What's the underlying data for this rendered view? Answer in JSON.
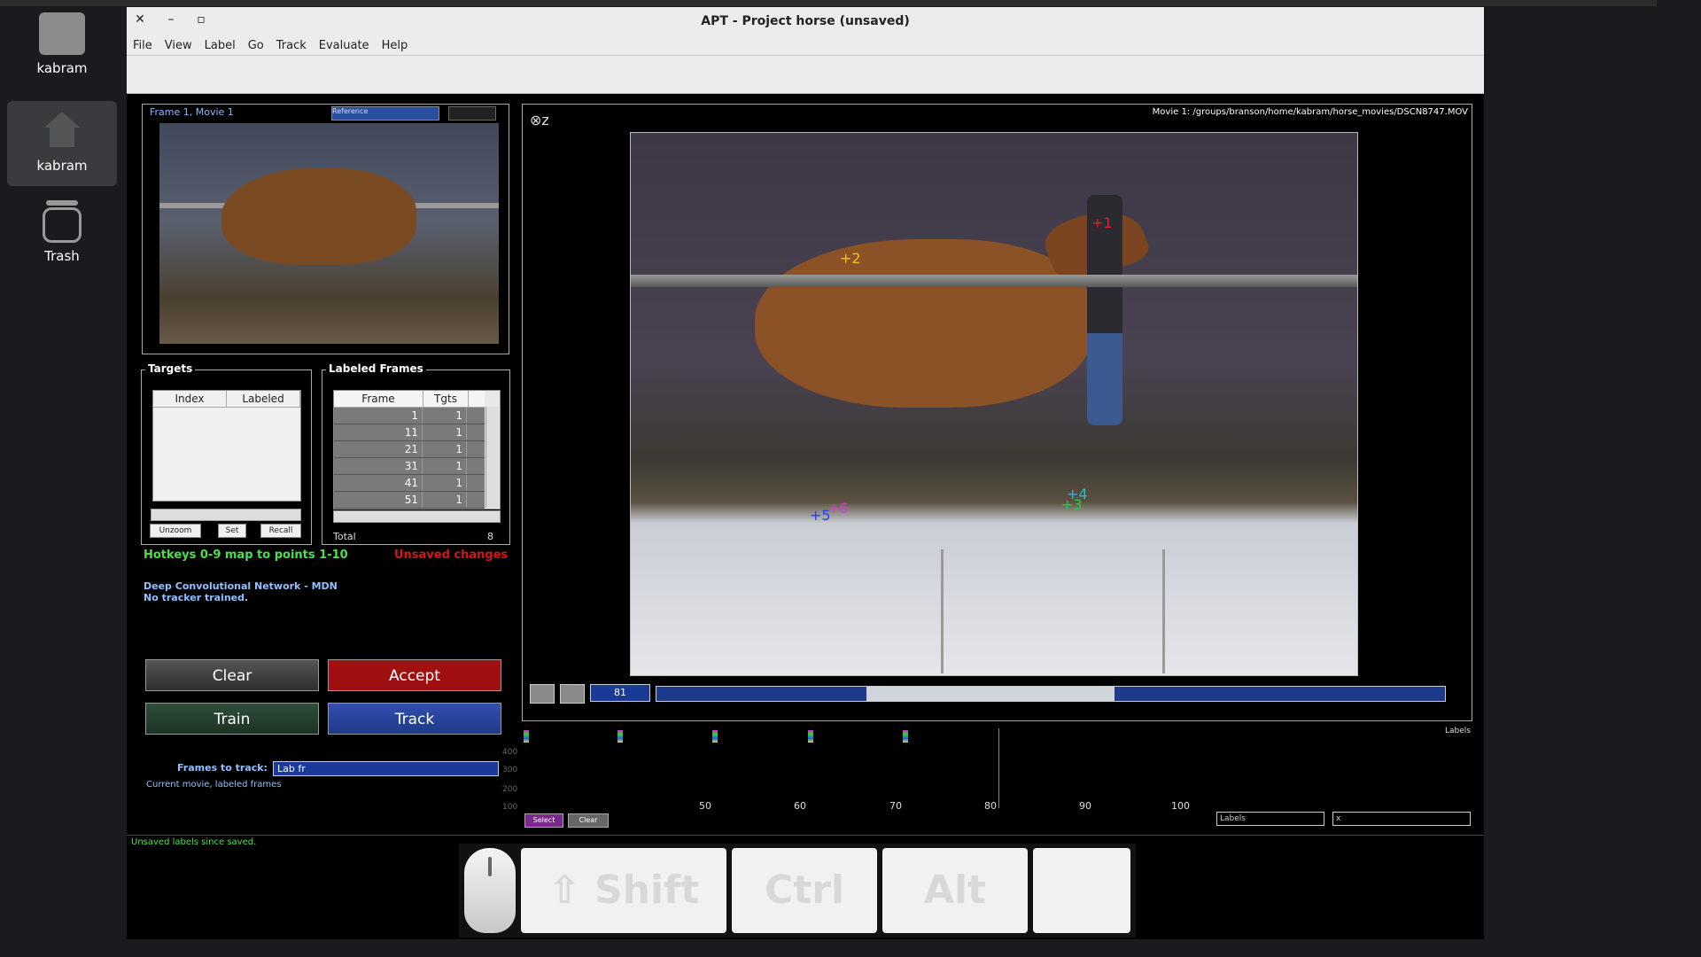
{
  "desktop": {
    "icons": [
      {
        "label": "kabram",
        "icon": "folder-icon"
      },
      {
        "label": "kabram",
        "icon": "home-icon"
      },
      {
        "label": "Trash",
        "icon": "trash-icon"
      }
    ]
  },
  "window": {
    "title": "APT - Project horse (unsaved)",
    "controls": {
      "close": "✕",
      "minimize": "–",
      "maximize": "▫"
    },
    "menu": [
      "File",
      "View",
      "Label",
      "Go",
      "Track",
      "Evaluate",
      "Help"
    ]
  },
  "reference_pane": {
    "label": "Frame 1, Movie 1",
    "select_value": "Reference"
  },
  "targets": {
    "title": "Targets",
    "columns": [
      "Index",
      "Labeled"
    ],
    "buttons": {
      "unzoom": "Unzoom",
      "set": "Set",
      "recall": "Recall"
    }
  },
  "labeled_frames": {
    "title": "Labeled Frames",
    "columns": [
      "Frame",
      "Tgts"
    ],
    "rows": [
      {
        "frame": "1",
        "tgts": "1"
      },
      {
        "frame": "11",
        "tgts": "1"
      },
      {
        "frame": "21",
        "tgts": "1"
      },
      {
        "frame": "31",
        "tgts": "1"
      },
      {
        "frame": "41",
        "tgts": "1"
      },
      {
        "frame": "51",
        "tgts": "1"
      }
    ],
    "total_label": "Total",
    "total_value": "8"
  },
  "status": {
    "hotkeys": "Hotkeys 0-9 map to points 1-10",
    "unsaved": "Unsaved changes",
    "tracker_line1": "Deep Convolutional Network - MDN",
    "tracker_line2": "No tracker trained.",
    "bottom": "Unsaved labels since  saved."
  },
  "actions": {
    "clear": "Clear",
    "accept": "Accept",
    "train": "Train",
    "track": "Track"
  },
  "frames_to_track": {
    "label": "Frames to track:",
    "value": "Lab fr",
    "subtitle": "Current movie, labeled frames"
  },
  "viewer": {
    "movie_path": "Movie 1: /groups/branson/home/kabram/horse_movies/DSCN8747.MOV",
    "zoom_icon": "⊗z",
    "keypoints": [
      {
        "id": "1",
        "color": "#e02020"
      },
      {
        "id": "2",
        "color": "#f0c020"
      },
      {
        "id": "3",
        "color": "#20d040"
      },
      {
        "id": "4",
        "color": "#20c0d0"
      },
      {
        "id": "5",
        "color": "#2040ff"
      },
      {
        "id": "6",
        "color": "#d040d0"
      }
    ],
    "current_frame": "81"
  },
  "timeline": {
    "x_ticks": [
      "50",
      "60",
      "70",
      "80",
      "90",
      "100"
    ],
    "y_ticks": [
      "400",
      "300",
      "200",
      "100"
    ],
    "right_label": "Labels",
    "select_btn": "Select",
    "clear_btn": "Clear",
    "field1": "Labels",
    "field2": "x"
  },
  "keys_overlay": {
    "shift": "⇧ Shift",
    "ctrl": "Ctrl",
    "alt": "Alt",
    "blank": ""
  }
}
